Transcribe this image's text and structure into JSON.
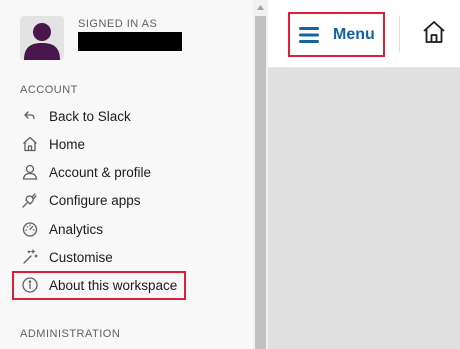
{
  "user": {
    "signed_in_label": "SIGNED IN AS"
  },
  "sidebar": {
    "account_header": "ACCOUNT",
    "administration_header": "ADMINISTRATION",
    "items": [
      {
        "label": "Back to Slack",
        "icon": "back-arrow-icon"
      },
      {
        "label": "Home",
        "icon": "home-icon"
      },
      {
        "label": "Account & profile",
        "icon": "person-icon"
      },
      {
        "label": "Configure apps",
        "icon": "plug-icon"
      },
      {
        "label": "Analytics",
        "icon": "speedometer-icon"
      },
      {
        "label": "Customise",
        "icon": "magic-wand-icon"
      },
      {
        "label": "About this workspace",
        "icon": "info-icon"
      }
    ]
  },
  "topbar": {
    "menu_label": "Menu"
  },
  "colors": {
    "accent": "#1264a3",
    "highlight": "#e01e3a",
    "avatar": "#4a154b"
  }
}
